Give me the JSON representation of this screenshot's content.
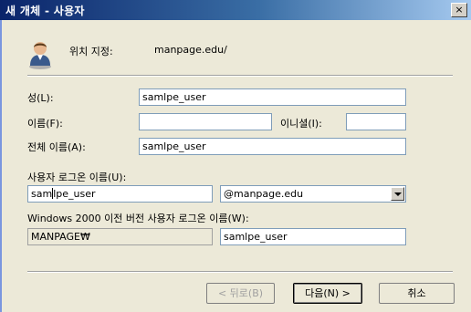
{
  "window": {
    "title": "새 개체 - 사용자",
    "close_glyph": "×"
  },
  "header": {
    "location_label": "위치 지정:",
    "location_value": "manpage.edu/"
  },
  "form": {
    "last_name": {
      "label": "성(L):",
      "value": "samlpe_user"
    },
    "first_name": {
      "label": "이름(F):",
      "value": ""
    },
    "initials": {
      "label": "이니셜(I):",
      "value": ""
    },
    "full_name": {
      "label": "전체 이름(A):",
      "value": "samlpe_user"
    },
    "logon_name": {
      "label": "사용자 로그온 이름(U):",
      "value_before_caret": "sam",
      "value_after_caret": "lpe_user"
    },
    "domain_select": {
      "value": "@manpage.edu"
    },
    "pre2000_label": "Windows 2000 이전 버전 사용자 로그온 이름(W):",
    "pre2000_domain": {
      "value": "MANPAGE₩"
    },
    "pre2000_name": {
      "value": "samlpe_user"
    }
  },
  "buttons": {
    "back": "< 뒤로(B)",
    "next": "다음(N) >",
    "cancel": "취소"
  },
  "colors": {
    "title_start": "#0a246a",
    "title_end": "#a6caf0",
    "dialog_bg": "#ece9d8",
    "field_border": "#7f9db9"
  }
}
